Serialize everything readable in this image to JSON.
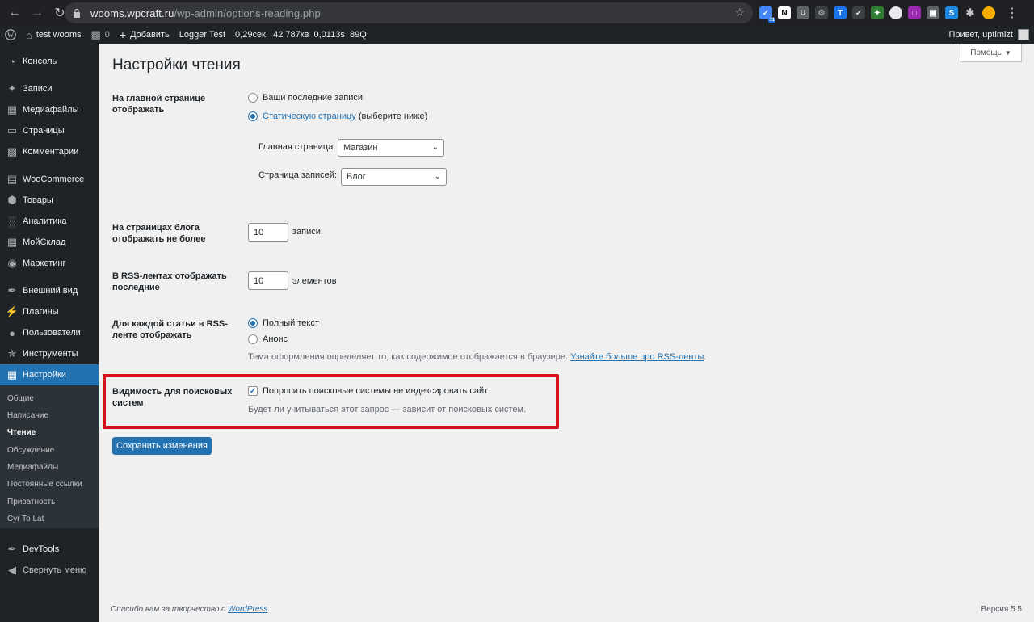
{
  "browser": {
    "url_host": "wooms.wpcraft.ru",
    "url_path": "/wp-admin/options-reading.php",
    "ext_badge": "31"
  },
  "admin_bar": {
    "site_name": "test wooms",
    "comments_count": "0",
    "add_label": "Добавить",
    "logger": "Logger Test",
    "time": "0,29сек.",
    "memory": "42 787кв",
    "query_time": "0,0113s",
    "queries": "89Q",
    "greeting": "Привет, uptimizt"
  },
  "sidebar": {
    "items": [
      {
        "label": "Консоль",
        "icon": "dashboard-icon"
      },
      {
        "label": "Записи",
        "icon": "pin-icon"
      },
      {
        "label": "Медиафайлы",
        "icon": "media-icon"
      },
      {
        "label": "Страницы",
        "icon": "page-icon"
      },
      {
        "label": "Комментарии",
        "icon": "comment-icon"
      },
      {
        "label": "WooCommerce",
        "icon": "woo-icon"
      },
      {
        "label": "Товары",
        "icon": "box-icon"
      },
      {
        "label": "Аналитика",
        "icon": "chart-icon"
      },
      {
        "label": "МойСклад",
        "icon": "grid-icon"
      },
      {
        "label": "Маркетинг",
        "icon": "megaphone-icon"
      },
      {
        "label": "Внешний вид",
        "icon": "brush-icon"
      },
      {
        "label": "Плагины",
        "icon": "plug-icon"
      },
      {
        "label": "Пользователи",
        "icon": "user-icon"
      },
      {
        "label": "Инструменты",
        "icon": "wrench-icon"
      },
      {
        "label": "Настройки",
        "icon": "settings-icon"
      },
      {
        "label": "DevTools",
        "icon": "tools-icon"
      },
      {
        "label": "Свернуть меню",
        "icon": "collapse-icon"
      }
    ],
    "submenu": [
      "Общие",
      "Написание",
      "Чтение",
      "Обсуждение",
      "Медиафайлы",
      "Постоянные ссылки",
      "Приватность",
      "Cyr To Lat"
    ]
  },
  "main": {
    "title": "Настройки чтения",
    "help": "Помощь",
    "front_page": {
      "label": "На главной странице отображать",
      "opt_latest": "Ваши последние записи",
      "opt_static_link": "Статическую страницу",
      "opt_static_rest": " (выберите ниже)",
      "homepage_label": "Главная страница:",
      "homepage_value": "Магазин",
      "posts_page_label": "Страница записей:",
      "posts_page_value": "Блог"
    },
    "blog_pages": {
      "label": "На страницах блога отображать не более",
      "value": "10",
      "unit": "записи"
    },
    "rss_items": {
      "label": "В RSS-лентах отображать последние",
      "value": "10",
      "unit": "элементов"
    },
    "rss_content": {
      "label": "Для каждой статьи в RSS-ленте отображать",
      "opt_full": "Полный текст",
      "opt_excerpt": "Анонс",
      "note": "Тема оформления определяет то, как содержимое отображается в браузере. ",
      "note_link": "Узнайте больше про RSS-ленты",
      "note_end": "."
    },
    "visibility": {
      "label": "Видимость для поисковых систем",
      "checkbox_label": "Попросить поисковые системы не индексировать сайт",
      "note": "Будет ли учитываться этот запрос — зависит от поисковых систем."
    },
    "save": "Сохранить изменения"
  },
  "footer": {
    "thanks": "Спасибо вам за творчество с ",
    "wp_link": "WordPress",
    "thanks_end": ".",
    "version": "Версия 5.5"
  }
}
